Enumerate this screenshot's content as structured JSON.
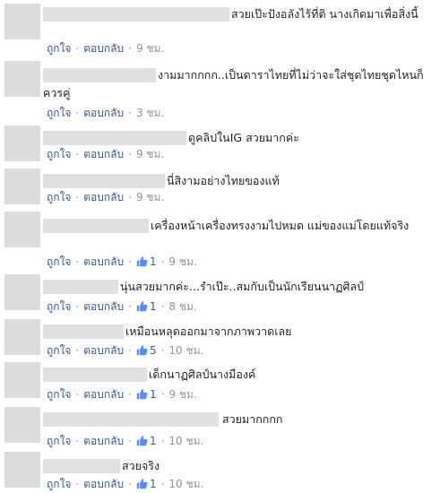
{
  "comments": [
    {
      "text": "สวยเป๊ะปังอลังไร้ที่ติ นางเกิดมาเพื่อสิ่งนี้",
      "like": "ถูกใจ",
      "reply": "ตอบกลับ",
      "likes": "",
      "time": "9 ชม."
    },
    {
      "text": "งามมากกกก..เป็นดาราไทยที่ไม่ว่าจะใส่ชุดไทยชุดไหนก็ควรคู่",
      "like": "ถูกใจ",
      "reply": "ตอบกลับ",
      "likes": "",
      "time": "3 ชม."
    },
    {
      "text": "ดูคลิปในIG สวยมากค่ะ",
      "like": "ถูกใจ",
      "reply": "ตอบกลับ",
      "likes": "",
      "time": "9 ชม."
    },
    {
      "text": "นี่สิงามอย่างไทยของแท้",
      "like": "ถูกใจ",
      "reply": "ตอบกลับ",
      "likes": "",
      "time": "9 ชม."
    },
    {
      "text": "เครื่องหน้าเครื่องทรงงามไปหมด แม่ของแม่โดยแท้จริง",
      "like": "ถูกใจ",
      "reply": "ตอบกลับ",
      "likes": "1",
      "time": "9 ชม."
    },
    {
      "text": "นุ่นสวยมากค่ะ...รำเป๊ะ..สมกับเป็นนักเรียนนาฏศิลป์",
      "like": "ถูกใจ",
      "reply": "ตอบกลับ",
      "likes": "1",
      "time": "8 ชม."
    },
    {
      "text": "เหมือนหลุดออกมาจากภาพวาดเลย",
      "like": "ถูกใจ",
      "reply": "ตอบกลับ",
      "likes": "5",
      "time": "10 ชม."
    },
    {
      "text": "เด็กนาฏศิลป์นางมืองค์",
      "like": "ถูกใจ",
      "reply": "ตอบกลับ",
      "likes": "1",
      "time": "9 ชม."
    },
    {
      "text": "สวยมากกกก",
      "like": "ถูกใจ",
      "reply": "ตอบกลับ",
      "likes": "1",
      "time": "10 ชม."
    },
    {
      "text": "สวยจริง",
      "like": "ถูกใจ",
      "reply": "ตอบกลับ",
      "likes": "1",
      "time": "10 ชม."
    }
  ],
  "colors": {
    "link": "#365899",
    "meta": "#90949c",
    "text": "#1d2129"
  },
  "icons": {
    "like": "thumbs-up-icon"
  }
}
